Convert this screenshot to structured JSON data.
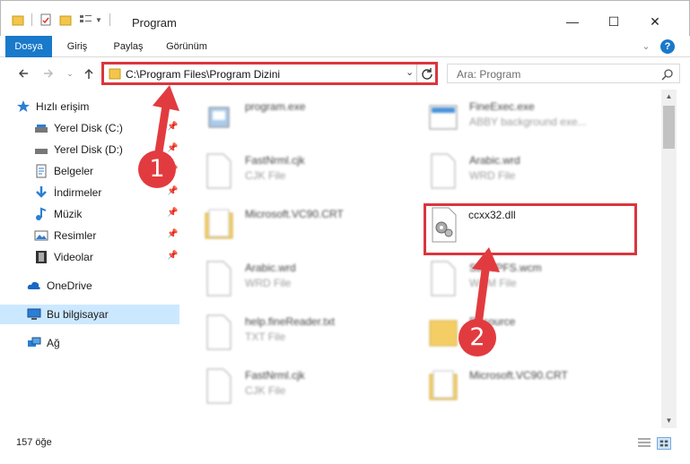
{
  "window": {
    "title": "Program",
    "minimize": "—",
    "maximize": "☐",
    "close": "✕"
  },
  "ribbon": {
    "tabs": [
      {
        "label": "Dosya",
        "active": true
      },
      {
        "label": "Giriş",
        "active": false
      },
      {
        "label": "Paylaş",
        "active": false
      },
      {
        "label": "Görünüm",
        "active": false
      }
    ],
    "expand": "⌄",
    "help": "?"
  },
  "address": {
    "path": "C:\\Program Files\\Program Dizini",
    "search_placeholder": "Ara: Program"
  },
  "nav": {
    "items": [
      {
        "label": "Hızlı erişim",
        "icon": "star-icon"
      },
      {
        "label": "Yerel Disk (C:)",
        "icon": "drive-icon",
        "pinned": true
      },
      {
        "label": "Yerel Disk (D:)",
        "icon": "drive-icon",
        "pinned": true
      },
      {
        "label": "Belgeler",
        "icon": "document-icon",
        "pinned": true
      },
      {
        "label": "İndirmeler",
        "icon": "download-icon",
        "pinned": true
      },
      {
        "label": "Müzik",
        "icon": "music-icon",
        "pinned": true
      },
      {
        "label": "Resimler",
        "icon": "pictures-icon",
        "pinned": true
      },
      {
        "label": "Videolar",
        "icon": "video-icon",
        "pinned": true
      },
      {
        "label": "OneDrive",
        "icon": "cloud-icon"
      },
      {
        "label": "Bu bilgisayar",
        "icon": "computer-icon",
        "selected": true
      },
      {
        "label": "Ağ",
        "icon": "network-icon"
      }
    ]
  },
  "files": [
    {
      "name": "program.exe",
      "type": "",
      "icon": "exe-icon",
      "blurred": true
    },
    {
      "name": "FineExec.exe",
      "type": "ABBY background exe...",
      "icon": "exe-icon",
      "blurred": true
    },
    {
      "name": "FastNrml.cjk",
      "type": "CJK File",
      "icon": "file-icon",
      "blurred": true
    },
    {
      "name": "Arabic.wrd",
      "type": "WRD File",
      "icon": "file-icon",
      "blurred": true
    },
    {
      "name": "Microsoft.VC90.CRT",
      "type": "",
      "icon": "folder-icon",
      "blurred": true
    },
    {
      "name": "ccxx32.dll",
      "type": "",
      "icon": "dll-icon",
      "blurred": false
    },
    {
      "name": "Arabic.wrd",
      "type": "WRD File",
      "icon": "file-icon",
      "blurred": true
    },
    {
      "name": "SbtWPFS.wcm",
      "type": "WCM File",
      "icon": "file-icon",
      "blurred": true
    },
    {
      "name": "help.fineReader.txt",
      "type": "TXT File",
      "icon": "file-icon",
      "blurred": true
    },
    {
      "name": "Resource",
      "type": "",
      "icon": "folder-icon",
      "blurred": true
    },
    {
      "name": "FastNrml.cjk",
      "type": "CJK File",
      "icon": "file-icon",
      "blurred": true
    },
    {
      "name": "Microsoft.VC90.CRT",
      "type": "",
      "icon": "folder-icon",
      "blurred": true
    }
  ],
  "status": {
    "count": "157 öğe"
  },
  "annotations": {
    "step1": "1",
    "step2": "2"
  },
  "colors": {
    "accent": "#1979ca",
    "annotation": "#e23b3f",
    "selected_nav": "#cce8ff"
  }
}
